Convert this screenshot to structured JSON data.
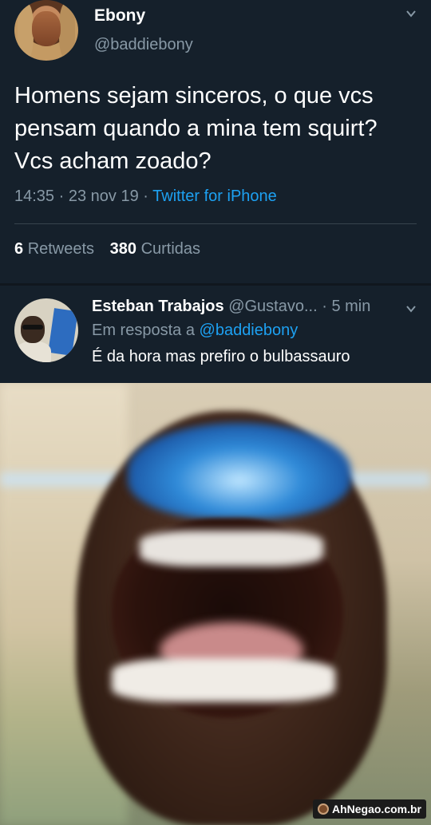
{
  "tweet": {
    "author_name": "Ebony",
    "author_handle": "@baddiebony",
    "text": "Homens sejam sinceros, o que vcs pensam quando a mina tem squirt? Vcs acham zoado?",
    "time": "14:35",
    "date": "23 nov 19",
    "separator": "·",
    "source": "Twitter for iPhone",
    "retweets_count": "6",
    "retweets_label": "Retweets",
    "likes_count": "380",
    "likes_label": "Curtidas"
  },
  "reply": {
    "author_name": "Esteban Trabajos",
    "author_handle": "@Gustavo...",
    "time": "5 min",
    "separator": "·",
    "reply_prefix": "Em resposta a",
    "reply_mention": "@baddiebony",
    "text": "É da hora mas prefiro o bulbassauro"
  },
  "watermark": {
    "text": "AhNegao.com.br"
  },
  "colors": {
    "background": "#15202b",
    "accent": "#1da1f2",
    "secondary_text": "#8899a6",
    "divider": "#38444d"
  },
  "icons": [
    "chevron-down-icon",
    "avatar",
    "watermark-icon"
  ]
}
